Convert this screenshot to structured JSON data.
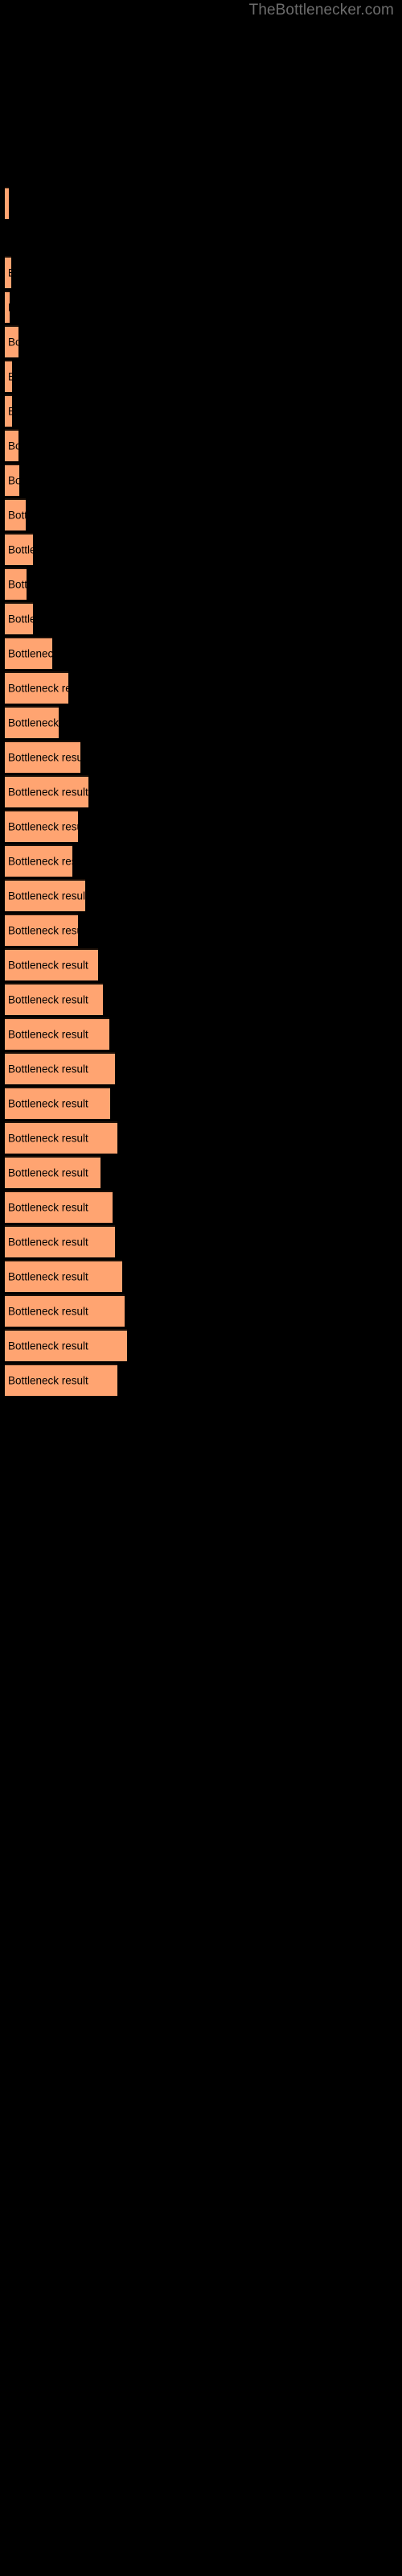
{
  "site": {
    "watermark": "TheBottlenecker.com"
  },
  "chart_data": {
    "type": "bar",
    "orientation": "horizontal",
    "title": "",
    "xlabel": "",
    "ylabel": "",
    "grid": false,
    "legend": null,
    "bar_color": "#ffa471",
    "bar_edge_color": "#1c1008",
    "background_color": "#000000",
    "label_color": "#000000",
    "axis_visible": false,
    "tick_labels": [],
    "xlim": [
      0,
      500
    ],
    "bar_label_text": "Bottleneck result",
    "categories": [
      "Bottleneck result",
      "Bottleneck result",
      "Bottleneck result",
      "Bottleneck result",
      "Bottleneck result",
      "Bottleneck result",
      "Bottleneck result",
      "Bottleneck result",
      "Bottleneck result",
      "Bottleneck result",
      "Bottleneck result",
      "Bottleneck result",
      "Bottleneck result",
      "Bottleneck result",
      "Bottleneck result",
      "Bottleneck result",
      "Bottleneck result",
      "Bottleneck result",
      "Bottleneck result",
      "Bottleneck result",
      "Bottleneck result",
      "Bottleneck result",
      "Bottleneck result",
      "Bottleneck result",
      "Bottleneck result",
      "Bottleneck result",
      "Bottleneck result",
      "Bottleneck result",
      "Bottleneck result",
      "Bottleneck result",
      "Bottleneck result",
      "Bottleneck result",
      "Bottleneck result",
      "Bottleneck result"
    ],
    "values": [
      3,
      5,
      4,
      11,
      6,
      6,
      11,
      12,
      17,
      23,
      18,
      23,
      39,
      52,
      44,
      62,
      68,
      60,
      55,
      66,
      60,
      76,
      80,
      85,
      90,
      86,
      92,
      78,
      88,
      90,
      96,
      98,
      100,
      92
    ],
    "bar_pixel_widths": [
      5,
      8,
      6,
      17,
      9,
      9,
      17,
      18,
      26,
      35,
      27,
      35,
      59,
      79,
      67,
      94,
      104,
      91,
      84,
      100,
      91,
      116,
      122,
      130,
      137,
      131,
      140,
      119,
      134,
      137,
      146,
      149,
      152,
      140
    ],
    "bar_pixel_tops": [
      232,
      318,
      361,
      404,
      447,
      490,
      533,
      576,
      619,
      662,
      705,
      748,
      791,
      834,
      877,
      920,
      963,
      1006,
      1049,
      1092,
      1135,
      1178,
      1221,
      1264,
      1307,
      1350,
      1393,
      1436,
      1479,
      1522,
      1565,
      1608,
      1651,
      1694
    ]
  }
}
